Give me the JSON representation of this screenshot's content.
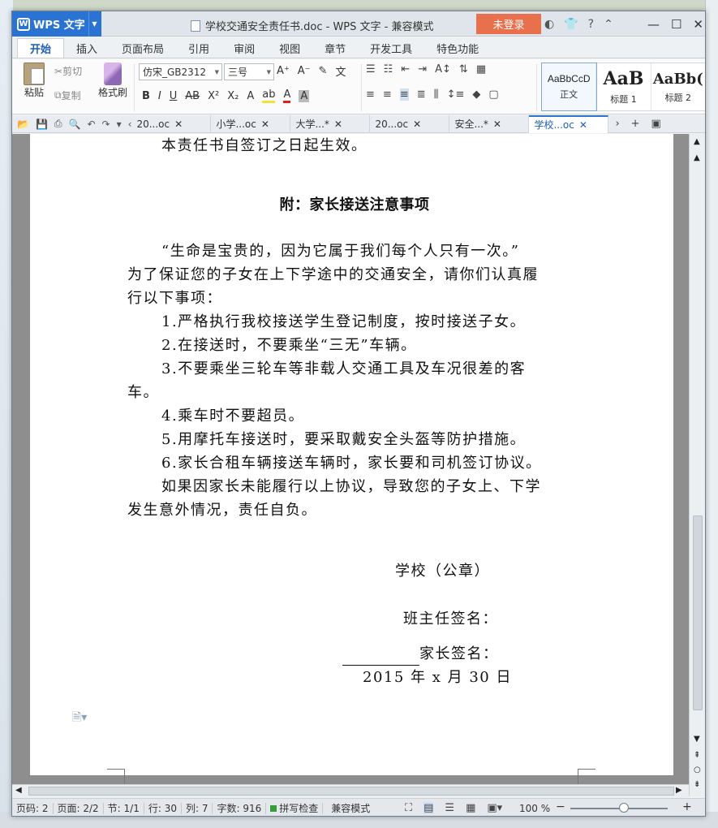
{
  "titlebar": {
    "app_name": "WPS 文字",
    "doc_title": "学校交通安全责任书.doc - WPS 文字 - 兼容模式",
    "login": "未登录"
  },
  "menu": {
    "tabs": [
      "开始",
      "插入",
      "页面布局",
      "引用",
      "审阅",
      "视图",
      "章节",
      "开发工具",
      "特色功能"
    ]
  },
  "ribbon": {
    "paste": "粘贴",
    "cut": "剪切",
    "copy": "复制",
    "format_painter": "格式刷",
    "font_name": "仿宋_GB2312",
    "font_size": "三号",
    "styles": [
      {
        "preview": "AaBbCcD",
        "name": "正文"
      },
      {
        "preview": "AaB",
        "name": "标题 1"
      },
      {
        "preview": "AaBb(",
        "name": "标题 2"
      }
    ]
  },
  "doc_tabs": [
    "20...oc",
    "小学...oc",
    "大学...*",
    "20...oc",
    "安全...*",
    "学校...oc"
  ],
  "document": {
    "lines": [
      "本责任书自签订之日起生效。",
      "附：家长接送注意事项",
      "“生命是宝贵的，因为它属于我们每个人只有一次。”",
      "为了保证您的子女在上下学途中的交通安全，请你们认真履",
      "行以下事项：",
      "1.严格执行我校接送学生登记制度，按时接送子女。",
      "2.在接送时，不要乘坐“三无”车辆。",
      "3.不要乘坐三轮车等非载人交通工具及车况很差的客",
      "车。",
      "4.乘车时不要超员。",
      "5.用摩托车接送时，要采取戴安全头盔等防护措施。",
      "6.家长合租车辆接送车辆时，家长要和司机签订协议。",
      "如果因家长未能履行以上协议，导致您的子女上、下学",
      "发生意外情况，责任自负。",
      "学校（公章）",
      "班主任签名：",
      "家长签名：",
      "2015 年 x 月 30 日"
    ]
  },
  "status": {
    "page_no": "页码: 2",
    "pages": "页面: 2/2",
    "section": "节: 1/1",
    "row": "行: 30",
    "col": "列: 7",
    "words": "字数: 916",
    "spell": "拼写检查",
    "mode": "兼容模式",
    "zoom": "100 %"
  },
  "colors": {
    "accent": "#2b73d2",
    "login": "#e9704d"
  }
}
